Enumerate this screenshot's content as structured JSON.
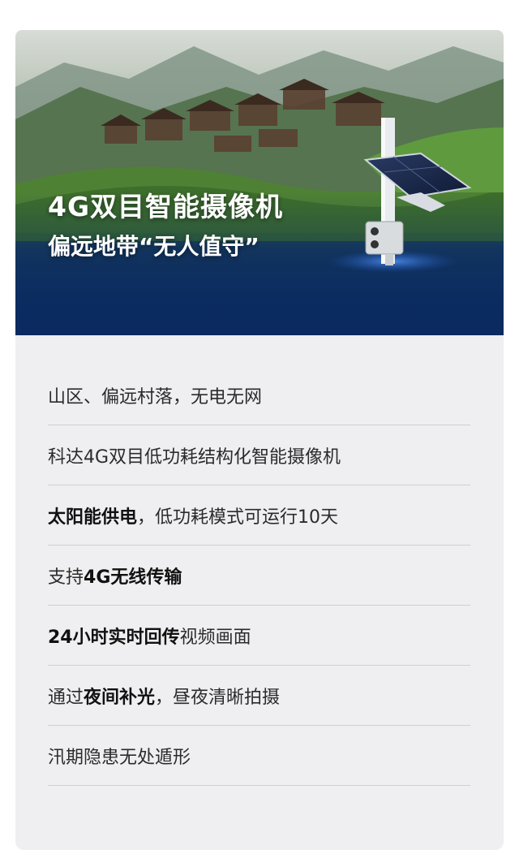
{
  "hero": {
    "title": "4G双目智能摄像机",
    "subtitle": "偏远地带“无人值守”",
    "colors": {
      "sky": "#c9d0c8",
      "mountain": "#4f6f55",
      "terrace": "#5a8a3c",
      "night_blue": "#0b2d66",
      "glow": "#2f6fd6"
    }
  },
  "features": [
    {
      "segments": [
        {
          "text": "山区、偏远村落，无电无网",
          "bold": false
        }
      ]
    },
    {
      "segments": [
        {
          "text": "科达4G双目低功耗结构化智能摄像机",
          "bold": false
        }
      ]
    },
    {
      "segments": [
        {
          "text": "太阳能供电",
          "bold": true
        },
        {
          "text": "，低功耗模式可运行10天",
          "bold": false
        }
      ]
    },
    {
      "segments": [
        {
          "text": "支持",
          "bold": false
        },
        {
          "text": "4G无线传输",
          "bold": true
        }
      ]
    },
    {
      "segments": [
        {
          "text": "24小时实时回传",
          "bold": true
        },
        {
          "text": "视频画面",
          "bold": false
        }
      ]
    },
    {
      "segments": [
        {
          "text": "通过",
          "bold": false
        },
        {
          "text": "夜间补光",
          "bold": true
        },
        {
          "text": "，昼夜清晰拍摄",
          "bold": false
        }
      ]
    },
    {
      "segments": [
        {
          "text": "汛期隐患无处遁形",
          "bold": false
        }
      ]
    }
  ]
}
